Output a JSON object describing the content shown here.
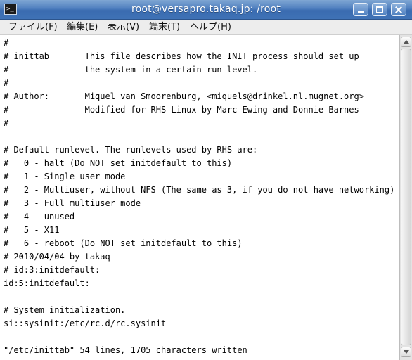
{
  "window": {
    "title": "root@versapro.takaq.jp: /root",
    "icon": "terminal-icon",
    "icon_glyph": ">_",
    "controls": [
      "minimize-icon",
      "maximize-icon",
      "close-icon"
    ]
  },
  "menubar": {
    "items": [
      "ファイル(F)",
      "編集(E)",
      "表示(V)",
      "端末(T)",
      "ヘルプ(H)"
    ]
  },
  "terminal": {
    "lines": [
      "#",
      "# inittab       This file describes how the INIT process should set up",
      "#               the system in a certain run-level.",
      "#",
      "# Author:       Miquel van Smoorenburg, <miquels@drinkel.nl.mugnet.org>",
      "#               Modified for RHS Linux by Marc Ewing and Donnie Barnes",
      "#",
      "",
      "# Default runlevel. The runlevels used by RHS are:",
      "#   0 - halt (Do NOT set initdefault to this)",
      "#   1 - Single user mode",
      "#   2 - Multiuser, without NFS (The same as 3, if you do not have networking)",
      "#   3 - Full multiuser mode",
      "#   4 - unused",
      "#   5 - X11",
      "#   6 - reboot (Do NOT set initdefault to this)",
      "# 2010/04/04 by takaq",
      "# id:3:initdefault:",
      "id:5:initdefault:",
      "",
      "# System initialization.",
      "si::sysinit:/etc/rc.d/rc.sysinit",
      "",
      "\"/etc/inittab\" 54 lines, 1705 characters written"
    ]
  },
  "scrollbar": {
    "up_icon": "scroll-up-arrow-icon",
    "down_icon": "scroll-down-arrow-icon",
    "thumb_fraction": 1.0
  },
  "colors": {
    "titlebar": "#3a6bb0",
    "menubar": "#ededed",
    "terminal_bg": "#ffffff",
    "terminal_fg": "#000000"
  }
}
